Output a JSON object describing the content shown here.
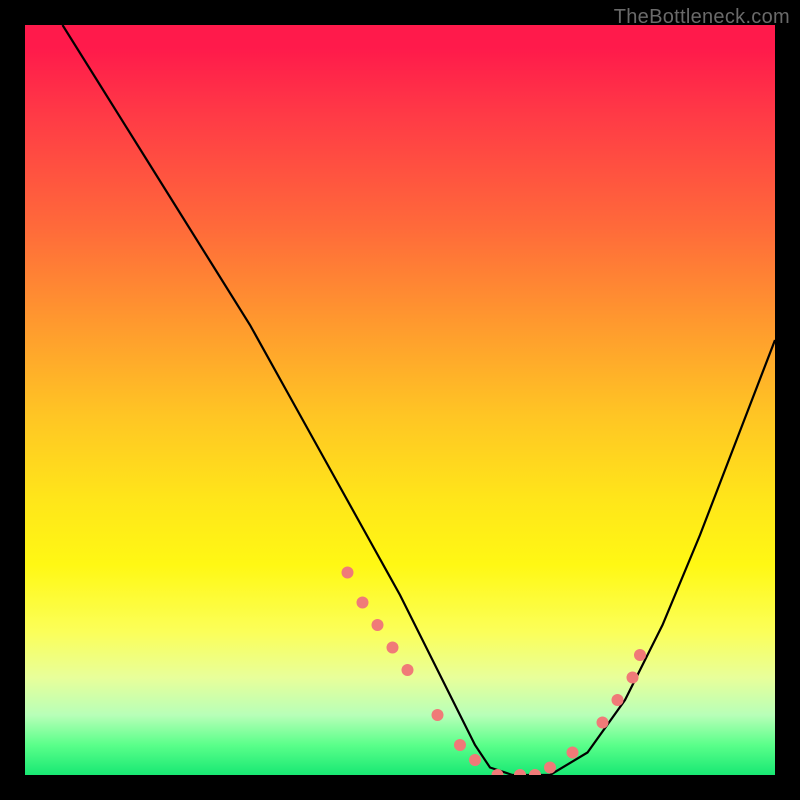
{
  "watermark": "TheBottleneck.com",
  "chart_data": {
    "type": "line",
    "title": "",
    "xlabel": "",
    "ylabel": "",
    "xlim": [
      0,
      100
    ],
    "ylim": [
      0,
      100
    ],
    "curve": {
      "name": "bottleneck-curve",
      "color": "#000000",
      "x": [
        5,
        10,
        15,
        20,
        25,
        30,
        35,
        40,
        45,
        50,
        55,
        58,
        60,
        62,
        65,
        70,
        75,
        80,
        85,
        90,
        95,
        100
      ],
      "y": [
        100,
        92,
        84,
        76,
        68,
        60,
        51,
        42,
        33,
        24,
        14,
        8,
        4,
        1,
        0,
        0,
        3,
        10,
        20,
        32,
        45,
        58
      ]
    },
    "markers": {
      "name": "highlight-dots",
      "color": "#f07a78",
      "radius": 6,
      "x": [
        43,
        45,
        47,
        49,
        51,
        55,
        58,
        60,
        63,
        66,
        68,
        70,
        73,
        77,
        79,
        81,
        82
      ],
      "y": [
        27,
        23,
        20,
        17,
        14,
        8,
        4,
        2,
        0,
        0,
        0,
        1,
        3,
        7,
        10,
        13,
        16
      ]
    },
    "gradient_bands": [
      {
        "color": "#ff1a4b",
        "stop": 0
      },
      {
        "color": "#ff6a3a",
        "stop": 27
      },
      {
        "color": "#ffc524",
        "stop": 52
      },
      {
        "color": "#fff814",
        "stop": 72
      },
      {
        "color": "#e8ff9a",
        "stop": 87
      },
      {
        "color": "#18e873",
        "stop": 100
      }
    ]
  }
}
